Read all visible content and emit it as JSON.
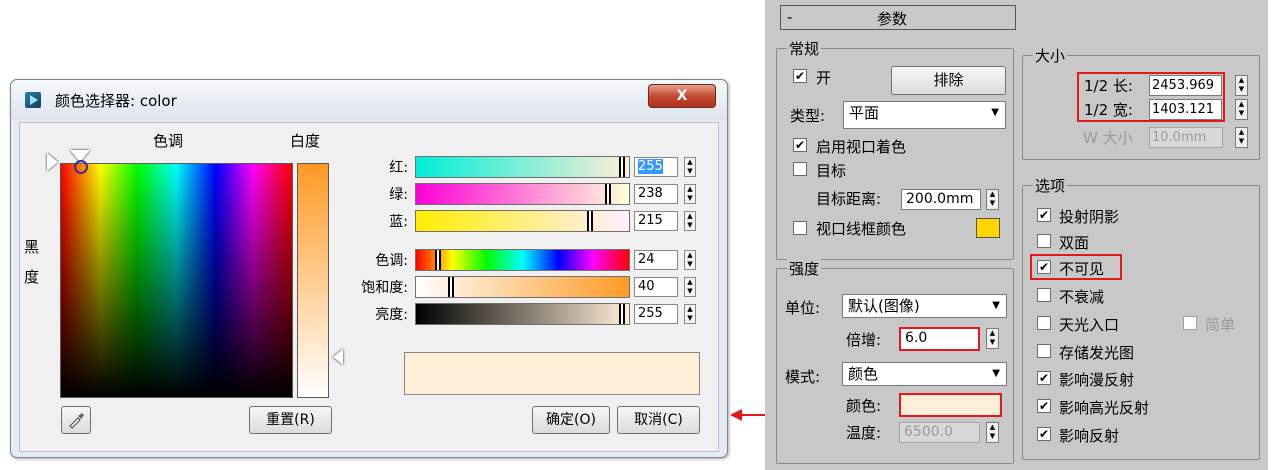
{
  "dialog": {
    "title": "颜色选择器: color",
    "close_label": "X",
    "hue_label": "色调",
    "whiteness_label": "白度",
    "blackness_label_1": "黑",
    "blackness_label_2": "度",
    "channels": [
      {
        "label": "红:",
        "value": "255",
        "level": 255
      },
      {
        "label": "绿:",
        "value": "238",
        "level": 238
      },
      {
        "label": "蓝:",
        "value": "215",
        "level": 215
      },
      {
        "label": "色调:",
        "value": "24",
        "level": 24
      },
      {
        "label": "饱和度:",
        "value": "40",
        "level": 40
      },
      {
        "label": "亮度:",
        "value": "255",
        "level": 255
      }
    ],
    "preview_color": "#ffeed7",
    "reset_label": "重置(R)",
    "ok_label": "确定(O)",
    "cancel_label": "取消(C)"
  },
  "panel": {
    "collapse_symbol": "-",
    "title": "参数",
    "general": {
      "title": "常规",
      "on_label": "开",
      "on_checked": true,
      "exclude_label": "排除",
      "type_label": "类型:",
      "type_value": "平面",
      "viewport_shading_label": "启用视口着色",
      "viewport_shading_checked": true,
      "target_label": "目标",
      "target_checked": false,
      "target_distance_label": "目标距离:",
      "target_distance_value": "200.0mm",
      "wire_color_label": "视口线框颜色",
      "wire_color_checked": false,
      "wire_color": "#ffd600"
    },
    "intensity": {
      "title": "强度",
      "unit_label": "单位:",
      "unit_value": "默认(图像)",
      "multiplier_label": "倍增:",
      "multiplier_value": "6.0",
      "mode_label": "模式:",
      "mode_value": "颜色",
      "color_label": "颜色:",
      "color_value": "#ffeed7",
      "temperature_label": "温度:",
      "temperature_value": "6500.0"
    },
    "size": {
      "title": "大小",
      "length_label": "1/2 长:",
      "length_value": "2453.969",
      "width_label": "1/2 宽:",
      "width_value": "1403.121",
      "w_size_label": "W 大小",
      "w_size_value": "10.0mm"
    },
    "options": {
      "title": "选项",
      "items": [
        {
          "label": "投射阴影",
          "checked": true
        },
        {
          "label": "双面",
          "checked": false
        },
        {
          "label": "不可见",
          "checked": true
        },
        {
          "label": "不衰减",
          "checked": false
        },
        {
          "label": "天光入口",
          "checked": false
        },
        {
          "label": "存储发光图",
          "checked": false
        },
        {
          "label": "影响漫反射",
          "checked": true
        },
        {
          "label": "影响高光反射",
          "checked": true
        },
        {
          "label": "影响反射",
          "checked": true
        }
      ],
      "simple_label": "简单",
      "simple_checked": false
    }
  },
  "annotation_color": "#e3171c"
}
